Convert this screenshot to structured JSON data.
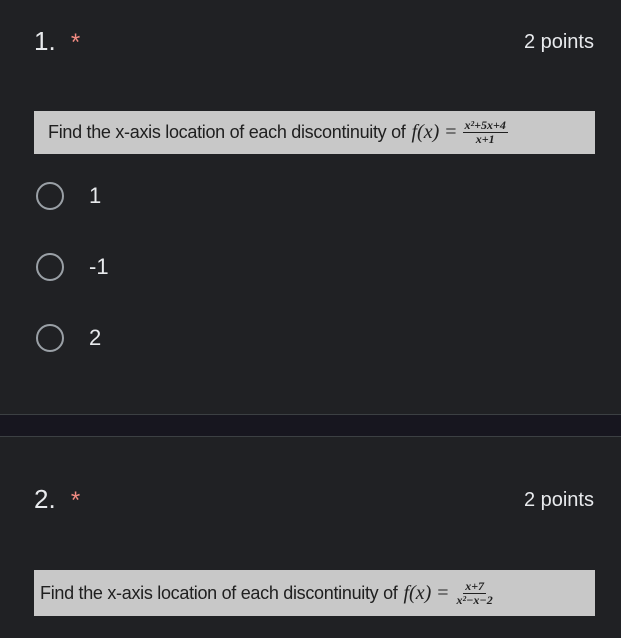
{
  "q1": {
    "number": "1.",
    "required_mark": "*",
    "points": "2 points",
    "prompt": "Find the x-axis location of each discontinuity of",
    "function_label": "f(x)",
    "equals": "=",
    "numerator": "x²+5x+4",
    "denominator": "x+1",
    "options": [
      {
        "label": "1"
      },
      {
        "label": "-1"
      },
      {
        "label": "2"
      }
    ]
  },
  "q2": {
    "number": "2.",
    "required_mark": "*",
    "points": "2 points",
    "prompt": "Find the x-axis location of each discontinuity of",
    "function_label": "f(x)",
    "equals": "=",
    "numerator": "x+7",
    "denominator": "x²−x−2"
  },
  "colors": {
    "background": "#202124",
    "text": "#e8eaed",
    "required": "#f28b82",
    "radio_border": "#9aa0a6",
    "image_bg": "#c8c8c8"
  }
}
